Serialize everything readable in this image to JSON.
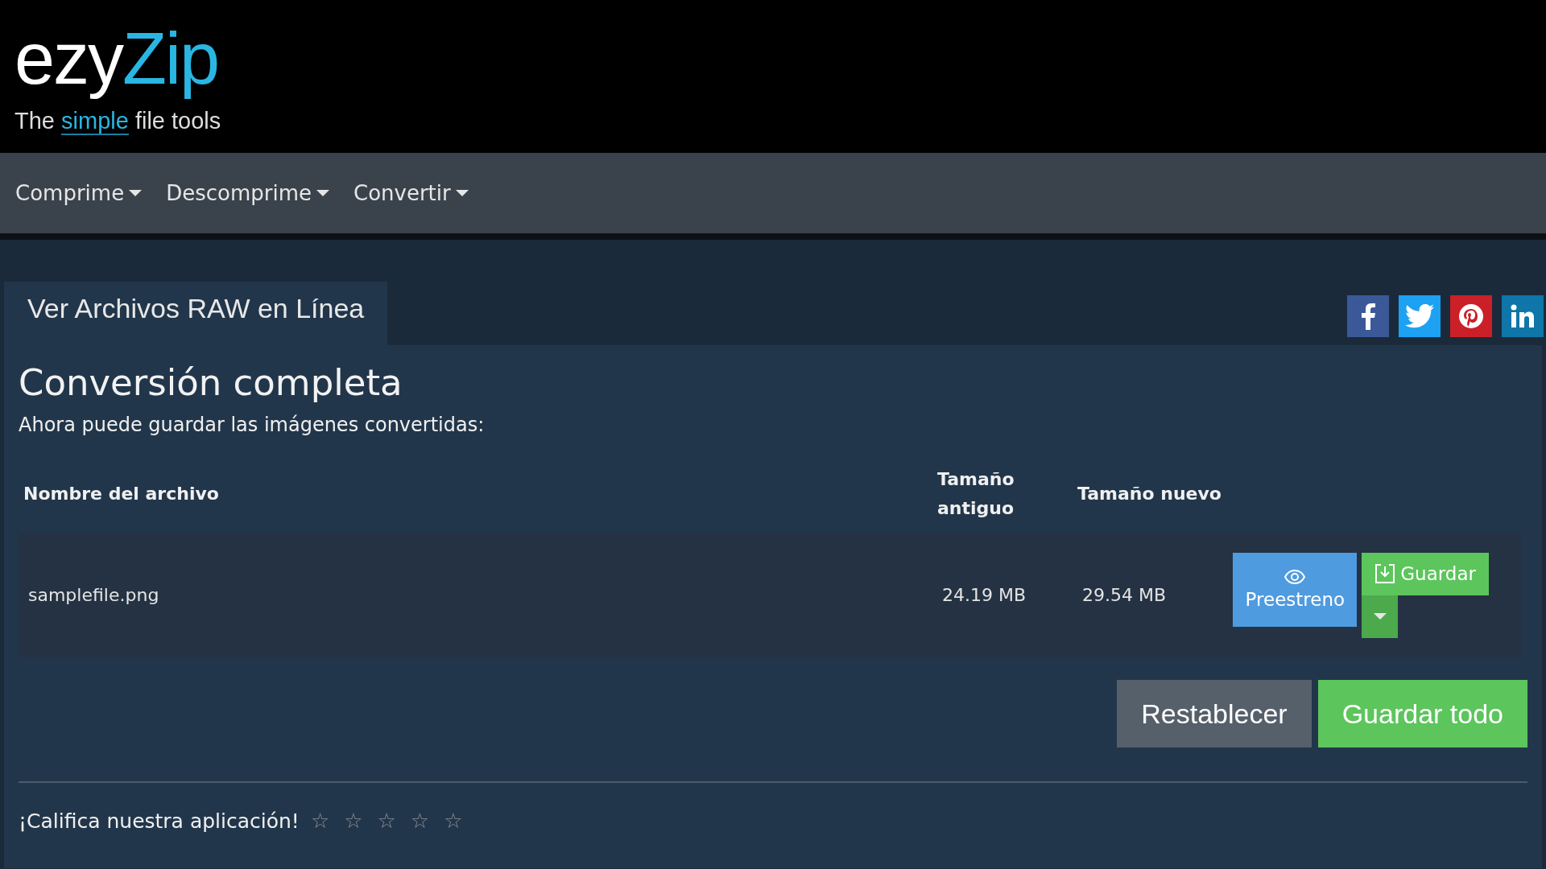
{
  "logo": {
    "word_a": "ezy",
    "word_b": "Zip",
    "tagline": [
      {
        "text": "The ",
        "accent": false
      },
      {
        "text": "simple",
        "accent": true
      },
      {
        "text": " file tools",
        "accent": false
      }
    ]
  },
  "nav": [
    {
      "label": "Comprime"
    },
    {
      "label": "Descomprime"
    },
    {
      "label": "Convertir"
    }
  ],
  "tab": {
    "label": "Ver Archivos RAW en Línea"
  },
  "share": [
    {
      "kind": "facebook",
      "color": "#3b5998"
    },
    {
      "kind": "twitter",
      "color": "#1da1f2"
    },
    {
      "kind": "pinterest",
      "color": "#cb2027"
    },
    {
      "kind": "linkedin",
      "color": "#0e76a8"
    }
  ],
  "heading": "Conversión completa",
  "subtitle": "Ahora puede guardar las imágenes convertidas:",
  "table": {
    "columns": [
      "Nombre del archivo",
      "Tamaño antiguo",
      "Tamaño nuevo"
    ],
    "rows": [
      {
        "name": "samplefile.png",
        "old_size": "24.19 MB",
        "new_size": "29.54 MB",
        "preview": "Preestreno",
        "save": "Guardar"
      }
    ]
  },
  "actions": {
    "reset": "Restablecer",
    "save_all": "Guardar todo"
  },
  "rating": {
    "label": "¡Califica nuestra aplicación!",
    "stars": 0
  }
}
